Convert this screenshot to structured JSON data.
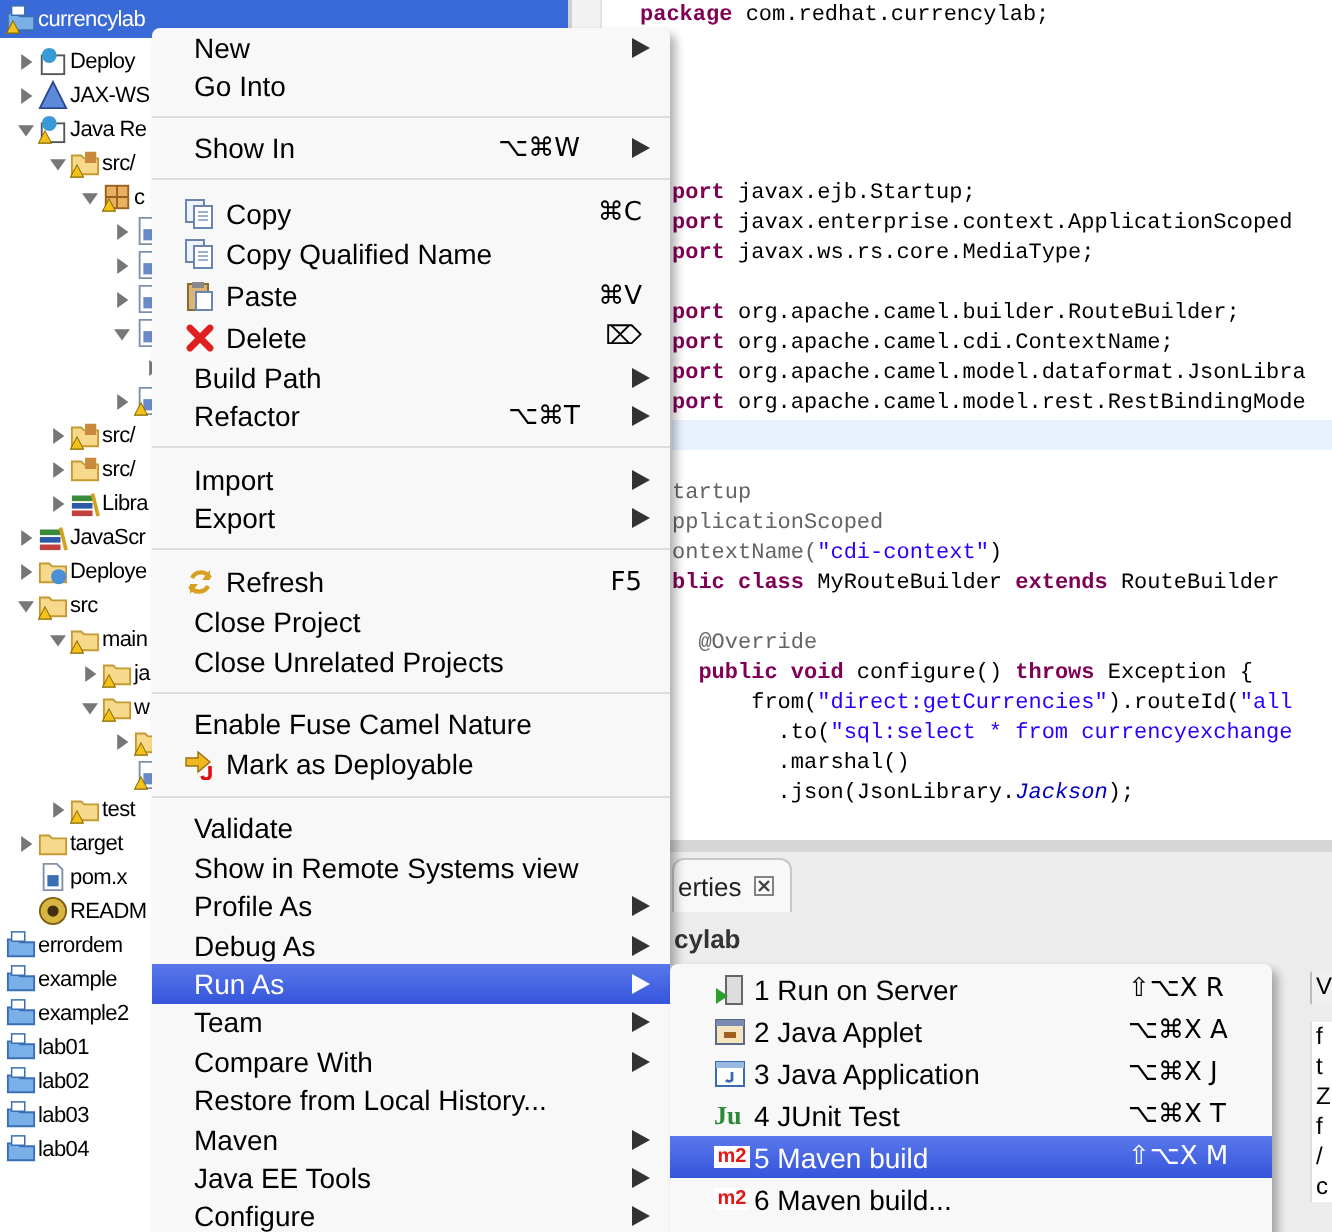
{
  "project_explorer": {
    "items": [
      {
        "label": "currencylab",
        "kind": "project",
        "warning": true,
        "selected": true,
        "children": [
          {
            "label": "Deploy",
            "kind": "descriptor",
            "warning": false,
            "selected": false,
            "expanded": false
          },
          {
            "label": "JAX-WS",
            "kind": "webservice",
            "warning": false,
            "selected": false,
            "expanded": false
          },
          {
            "label": "Java Re",
            "kind": "resources",
            "warning": true,
            "selected": false,
            "expanded": true,
            "children": [
              {
                "label": "src/",
                "kind": "source-folder",
                "warning": true,
                "selected": false,
                "expanded": true,
                "children": [
                  {
                    "label": "c",
                    "kind": "package",
                    "warning": true,
                    "selected": false,
                    "expanded": true,
                    "children": [
                      {
                        "kind": "java-file",
                        "warning": false,
                        "selected": false,
                        "expanded": false
                      },
                      {
                        "kind": "java-file",
                        "warning": false,
                        "selected": false,
                        "expanded": false
                      },
                      {
                        "kind": "java-file",
                        "warning": false,
                        "selected": false,
                        "expanded": false
                      },
                      {
                        "kind": "java-file",
                        "warning": false,
                        "selected": false,
                        "expanded": true,
                        "children": [
                          {
                            "selected": false,
                            "expanded": false
                          }
                        ]
                      },
                      {
                        "kind": "java-file",
                        "warning": true,
                        "selected": false,
                        "expanded": false
                      }
                    ]
                  }
                ]
              },
              {
                "label": "src/",
                "kind": "source-folder",
                "warning": true,
                "selected": false,
                "expanded": false
              },
              {
                "label": "src/",
                "kind": "source-folder",
                "warning": false,
                "selected": false,
                "expanded": false
              },
              {
                "label": "Libra",
                "kind": "library",
                "warning": false,
                "selected": false,
                "expanded": false
              }
            ]
          },
          {
            "label": "JavaScr",
            "kind": "library",
            "warning": false,
            "selected": false,
            "expanded": false
          },
          {
            "label": "Deploye",
            "kind": "deployed",
            "warning": false,
            "selected": false,
            "expanded": false
          },
          {
            "label": "src",
            "kind": "folder",
            "warning": true,
            "selected": false,
            "expanded": true,
            "children": [
              {
                "label": "main",
                "kind": "folder",
                "warning": true,
                "selected": false,
                "expanded": true,
                "children": [
                  {
                    "label": "ja",
                    "kind": "folder",
                    "warning": true,
                    "selected": false,
                    "expanded": false
                  },
                  {
                    "label": "w",
                    "kind": "folder",
                    "warning": true,
                    "selected": false,
                    "expanded": true,
                    "children": [
                      {
                        "kind": "folder",
                        "warning": true,
                        "selected": false,
                        "expanded": false
                      },
                      {
                        "kind": "page",
                        "warning": true,
                        "selected": false
                      }
                    ]
                  }
                ]
              },
              {
                "label": "test",
                "kind": "folder",
                "warning": true,
                "selected": false,
                "expanded": false
              }
            ]
          },
          {
            "label": "target",
            "kind": "folder",
            "warning": false,
            "selected": false,
            "expanded": false
          },
          {
            "label": "pom.x",
            "kind": "pom",
            "warning": false,
            "selected": false
          },
          {
            "label": "READM",
            "kind": "readme",
            "warning": false,
            "selected": false
          }
        ]
      },
      {
        "label": "errordem",
        "kind": "project",
        "warning": false,
        "selected": false
      },
      {
        "label": "example",
        "kind": "project",
        "warning": false,
        "selected": false
      },
      {
        "label": "example2",
        "kind": "project",
        "warning": false,
        "selected": false
      },
      {
        "label": "lab01",
        "kind": "project",
        "warning": false,
        "selected": false
      },
      {
        "label": "lab02",
        "kind": "project",
        "warning": false,
        "selected": false
      },
      {
        "label": "lab03",
        "kind": "project",
        "warning": false,
        "selected": false
      },
      {
        "label": "lab04",
        "kind": "project",
        "warning": false,
        "selected": false
      }
    ]
  },
  "editor": {
    "package_line": [
      {
        "text": "package",
        "kind": "keyword"
      },
      {
        "text": " com.redhat.currencylab;",
        "kind": "plain"
      }
    ],
    "lines": [
      {
        "kind": "code",
        "segments": [
          {
            "text": "port",
            "kind": "keyword"
          },
          {
            "text": " javax.ejb.Startup;",
            "kind": "plain"
          }
        ]
      },
      {
        "kind": "code",
        "segments": [
          {
            "text": "port",
            "kind": "keyword"
          },
          {
            "text": " javax.enterprise.context.ApplicationScoped",
            "kind": "plain"
          }
        ]
      },
      {
        "kind": "code",
        "segments": [
          {
            "text": "port",
            "kind": "keyword"
          },
          {
            "text": " javax.ws.rs.core.MediaType;",
            "kind": "plain"
          }
        ]
      },
      {
        "kind": "blank"
      },
      {
        "kind": "code",
        "segments": [
          {
            "text": "port",
            "kind": "keyword"
          },
          {
            "text": " org.apache.camel.builder.RouteBuilder;",
            "kind": "plain"
          }
        ]
      },
      {
        "kind": "code",
        "segments": [
          {
            "text": "port",
            "kind": "keyword"
          },
          {
            "text": " org.apache.camel.cdi.ContextName;",
            "kind": "plain"
          }
        ]
      },
      {
        "kind": "code",
        "segments": [
          {
            "text": "port",
            "kind": "keyword"
          },
          {
            "text": " org.apache.camel.model.dataformat.JsonLibra",
            "kind": "plain"
          }
        ]
      },
      {
        "kind": "code",
        "segments": [
          {
            "text": "port",
            "kind": "keyword"
          },
          {
            "text": " org.apache.camel.model.rest.RestBindingMode",
            "kind": "plain"
          }
        ]
      },
      {
        "kind": "current"
      },
      {
        "kind": "blank"
      },
      {
        "kind": "code",
        "segments": [
          {
            "text": "tartup",
            "kind": "annotation"
          }
        ]
      },
      {
        "kind": "code",
        "segments": [
          {
            "text": "pplicationScoped",
            "kind": "annotation"
          }
        ]
      },
      {
        "kind": "code",
        "segments": [
          {
            "text": "ontextName(",
            "kind": "annotation"
          },
          {
            "text": "\"cdi-context\"",
            "kind": "string"
          },
          {
            "text": ")",
            "kind": "plain"
          }
        ]
      },
      {
        "kind": "code",
        "segments": [
          {
            "text": "blic class",
            "kind": "keyword"
          },
          {
            "text": " MyRouteBuilder ",
            "kind": "plain"
          },
          {
            "text": "extends",
            "kind": "keyword"
          },
          {
            "text": " RouteBuilder",
            "kind": "plain"
          }
        ]
      },
      {
        "kind": "blank"
      },
      {
        "kind": "code",
        "segments": [
          {
            "text": "  @Override",
            "kind": "annotation"
          }
        ]
      },
      {
        "kind": "code",
        "segments": [
          {
            "text": "  public void",
            "kind": "keyword"
          },
          {
            "text": " configure() ",
            "kind": "plain"
          },
          {
            "text": "throws",
            "kind": "keyword"
          },
          {
            "text": " Exception {",
            "kind": "plain"
          }
        ]
      },
      {
        "kind": "code",
        "segments": [
          {
            "text": "      from(",
            "kind": "plain"
          },
          {
            "text": "\"direct:getCurrencies\"",
            "kind": "string"
          },
          {
            "text": ").routeId(",
            "kind": "plain"
          },
          {
            "text": "\"all",
            "kind": "string"
          }
        ]
      },
      {
        "kind": "code",
        "segments": [
          {
            "text": "        .to(",
            "kind": "plain"
          },
          {
            "text": "\"sql:select * from currencyexchange",
            "kind": "string"
          }
        ]
      },
      {
        "kind": "code",
        "segments": [
          {
            "text": "        .marshal()",
            "kind": "plain"
          }
        ]
      },
      {
        "kind": "code",
        "segments": [
          {
            "text": "        .json(JsonLibrary.",
            "kind": "plain"
          },
          {
            "text": "Jackson",
            "kind": "field"
          },
          {
            "text": ");",
            "kind": "plain"
          }
        ]
      }
    ]
  },
  "properties": {
    "tab": {
      "label": "erties"
    },
    "title": "cylab",
    "column_2": "V",
    "cells": [
      "f",
      "t",
      "Z",
      "f",
      "/",
      "c"
    ]
  },
  "context_menu": {
    "items": [
      {
        "kind": "item",
        "label": "New",
        "submenu": true,
        "selected": false
      },
      {
        "kind": "item",
        "label": "Go Into",
        "submenu": false,
        "selected": false
      },
      {
        "kind": "separator"
      },
      {
        "kind": "item",
        "label": "Show In",
        "shortcut": "⌥⌘W",
        "submenu": true,
        "selected": false
      },
      {
        "kind": "separator"
      },
      {
        "kind": "copy",
        "label": "Copy",
        "shortcut": "⌘C",
        "submenu": false,
        "selected": false
      },
      {
        "kind": "copy-name",
        "label": "Copy Qualified Name",
        "submenu": false,
        "selected": false
      },
      {
        "kind": "paste",
        "label": "Paste",
        "shortcut": "⌘V",
        "submenu": false,
        "selected": false
      },
      {
        "kind": "delete",
        "label": "Delete",
        "shortcut": "⌦",
        "submenu": false,
        "selected": false
      },
      {
        "kind": "item",
        "label": "Build Path",
        "submenu": true,
        "selected": false
      },
      {
        "kind": "item",
        "label": "Refactor",
        "shortcut": "⌥⌘T",
        "submenu": true,
        "selected": false
      },
      {
        "kind": "separator"
      },
      {
        "kind": "item",
        "label": "Import",
        "submenu": true,
        "selected": false
      },
      {
        "kind": "item",
        "label": "Export",
        "submenu": true,
        "selected": false
      },
      {
        "kind": "separator"
      },
      {
        "kind": "refresh",
        "label": "Refresh",
        "shortcut": "F5",
        "submenu": false,
        "selected": false
      },
      {
        "kind": "item",
        "label": "Close Project",
        "submenu": false,
        "selected": false
      },
      {
        "kind": "item",
        "label": "Close Unrelated Projects",
        "submenu": false,
        "selected": false
      },
      {
        "kind": "separator"
      },
      {
        "kind": "item",
        "label": "Enable Fuse Camel Nature",
        "submenu": false,
        "selected": false
      },
      {
        "kind": "deploy",
        "label": "Mark as Deployable",
        "submenu": false,
        "selected": false
      },
      {
        "kind": "separator"
      },
      {
        "kind": "item",
        "label": "Validate",
        "submenu": false,
        "selected": false
      },
      {
        "kind": "item",
        "label": "Show in Remote Systems view",
        "submenu": false,
        "selected": false
      },
      {
        "kind": "item",
        "label": "Profile As",
        "submenu": true,
        "selected": false
      },
      {
        "kind": "item",
        "label": "Debug As",
        "submenu": true,
        "selected": false
      },
      {
        "kind": "item",
        "label": "Run As",
        "submenu": true,
        "selected": true
      },
      {
        "kind": "item",
        "label": "Team",
        "submenu": true,
        "selected": false
      },
      {
        "kind": "item",
        "label": "Compare With",
        "submenu": true,
        "selected": false
      },
      {
        "kind": "item",
        "label": "Restore from Local History...",
        "submenu": false,
        "selected": false
      },
      {
        "kind": "item",
        "label": "Maven",
        "submenu": true,
        "selected": false
      },
      {
        "kind": "item",
        "label": "Java EE Tools",
        "submenu": true,
        "selected": false
      },
      {
        "kind": "item",
        "label": "Configure",
        "submenu": true,
        "selected": false
      }
    ]
  },
  "submenu": {
    "items": [
      {
        "label": "1 Run on Server",
        "kind": "server",
        "shortcut": "⇧⌥X R",
        "selected": false
      },
      {
        "label": "2 Java Applet",
        "kind": "applet",
        "shortcut": "⌥⌘X A",
        "selected": false
      },
      {
        "label": "3 Java Application",
        "kind": "application",
        "shortcut": "⌥⌘X J",
        "selected": false
      },
      {
        "label": "4 JUnit Test",
        "kind": "junit",
        "icon_text": "Ju",
        "shortcut": "⌥⌘X T",
        "selected": false
      },
      {
        "label": "5 Maven build",
        "kind": "maven",
        "icon_text": "m2",
        "shortcut": "⇧⌥X M",
        "selected": true
      },
      {
        "label": "6 Maven build...",
        "kind": "maven",
        "icon_text": "m2",
        "selected": false
      }
    ]
  }
}
